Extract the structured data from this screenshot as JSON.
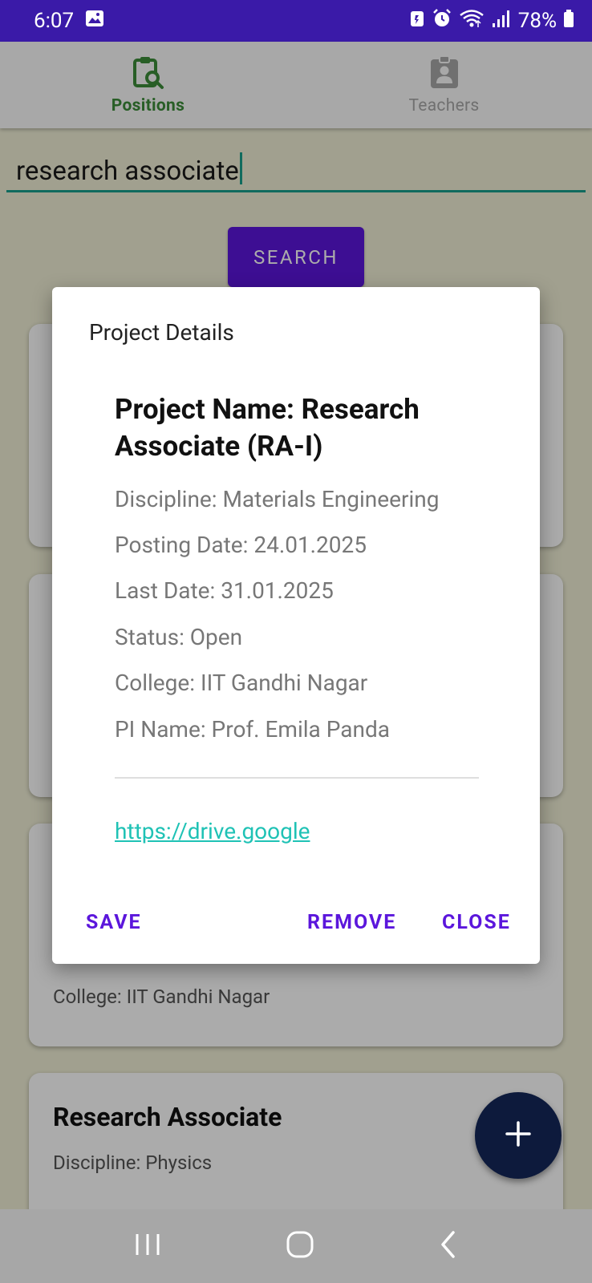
{
  "status_bar": {
    "time": "6:07",
    "battery": "78%"
  },
  "tabs": [
    {
      "label": "Positions",
      "icon": "clipboard-search-icon",
      "active": true
    },
    {
      "label": "Teachers",
      "icon": "contact-badge-icon",
      "active": false
    }
  ],
  "search": {
    "value": "research associate",
    "button_label": "SEARCH"
  },
  "cards": [
    {
      "college": "College: IIT Gandhi Nagar"
    },
    {
      "title": "Research Associate",
      "discipline": "Discipline: Physics"
    }
  ],
  "dialog": {
    "title": "Project Details",
    "project_name": "Project Name: Research Associate (RA-I)",
    "details": [
      "Discipline: Materials Engineering",
      "Posting Date: 24.01.2025",
      "Last Date: 31.01.2025",
      "Status: Open",
      "College: IIT Gandhi Nagar",
      "PI Name: Prof. Emila Panda"
    ],
    "link": "https://drive.google",
    "buttons": {
      "save": "SAVE",
      "remove": "REMOVE",
      "close": "CLOSE"
    }
  },
  "colors": {
    "status_bar": "#3a1aa8",
    "accent_purple": "#5b16dc",
    "active_tab": "#3c8c3a",
    "teal": "#1aa08c",
    "link": "#1fc2b5",
    "fab": "#0d1a3c"
  }
}
